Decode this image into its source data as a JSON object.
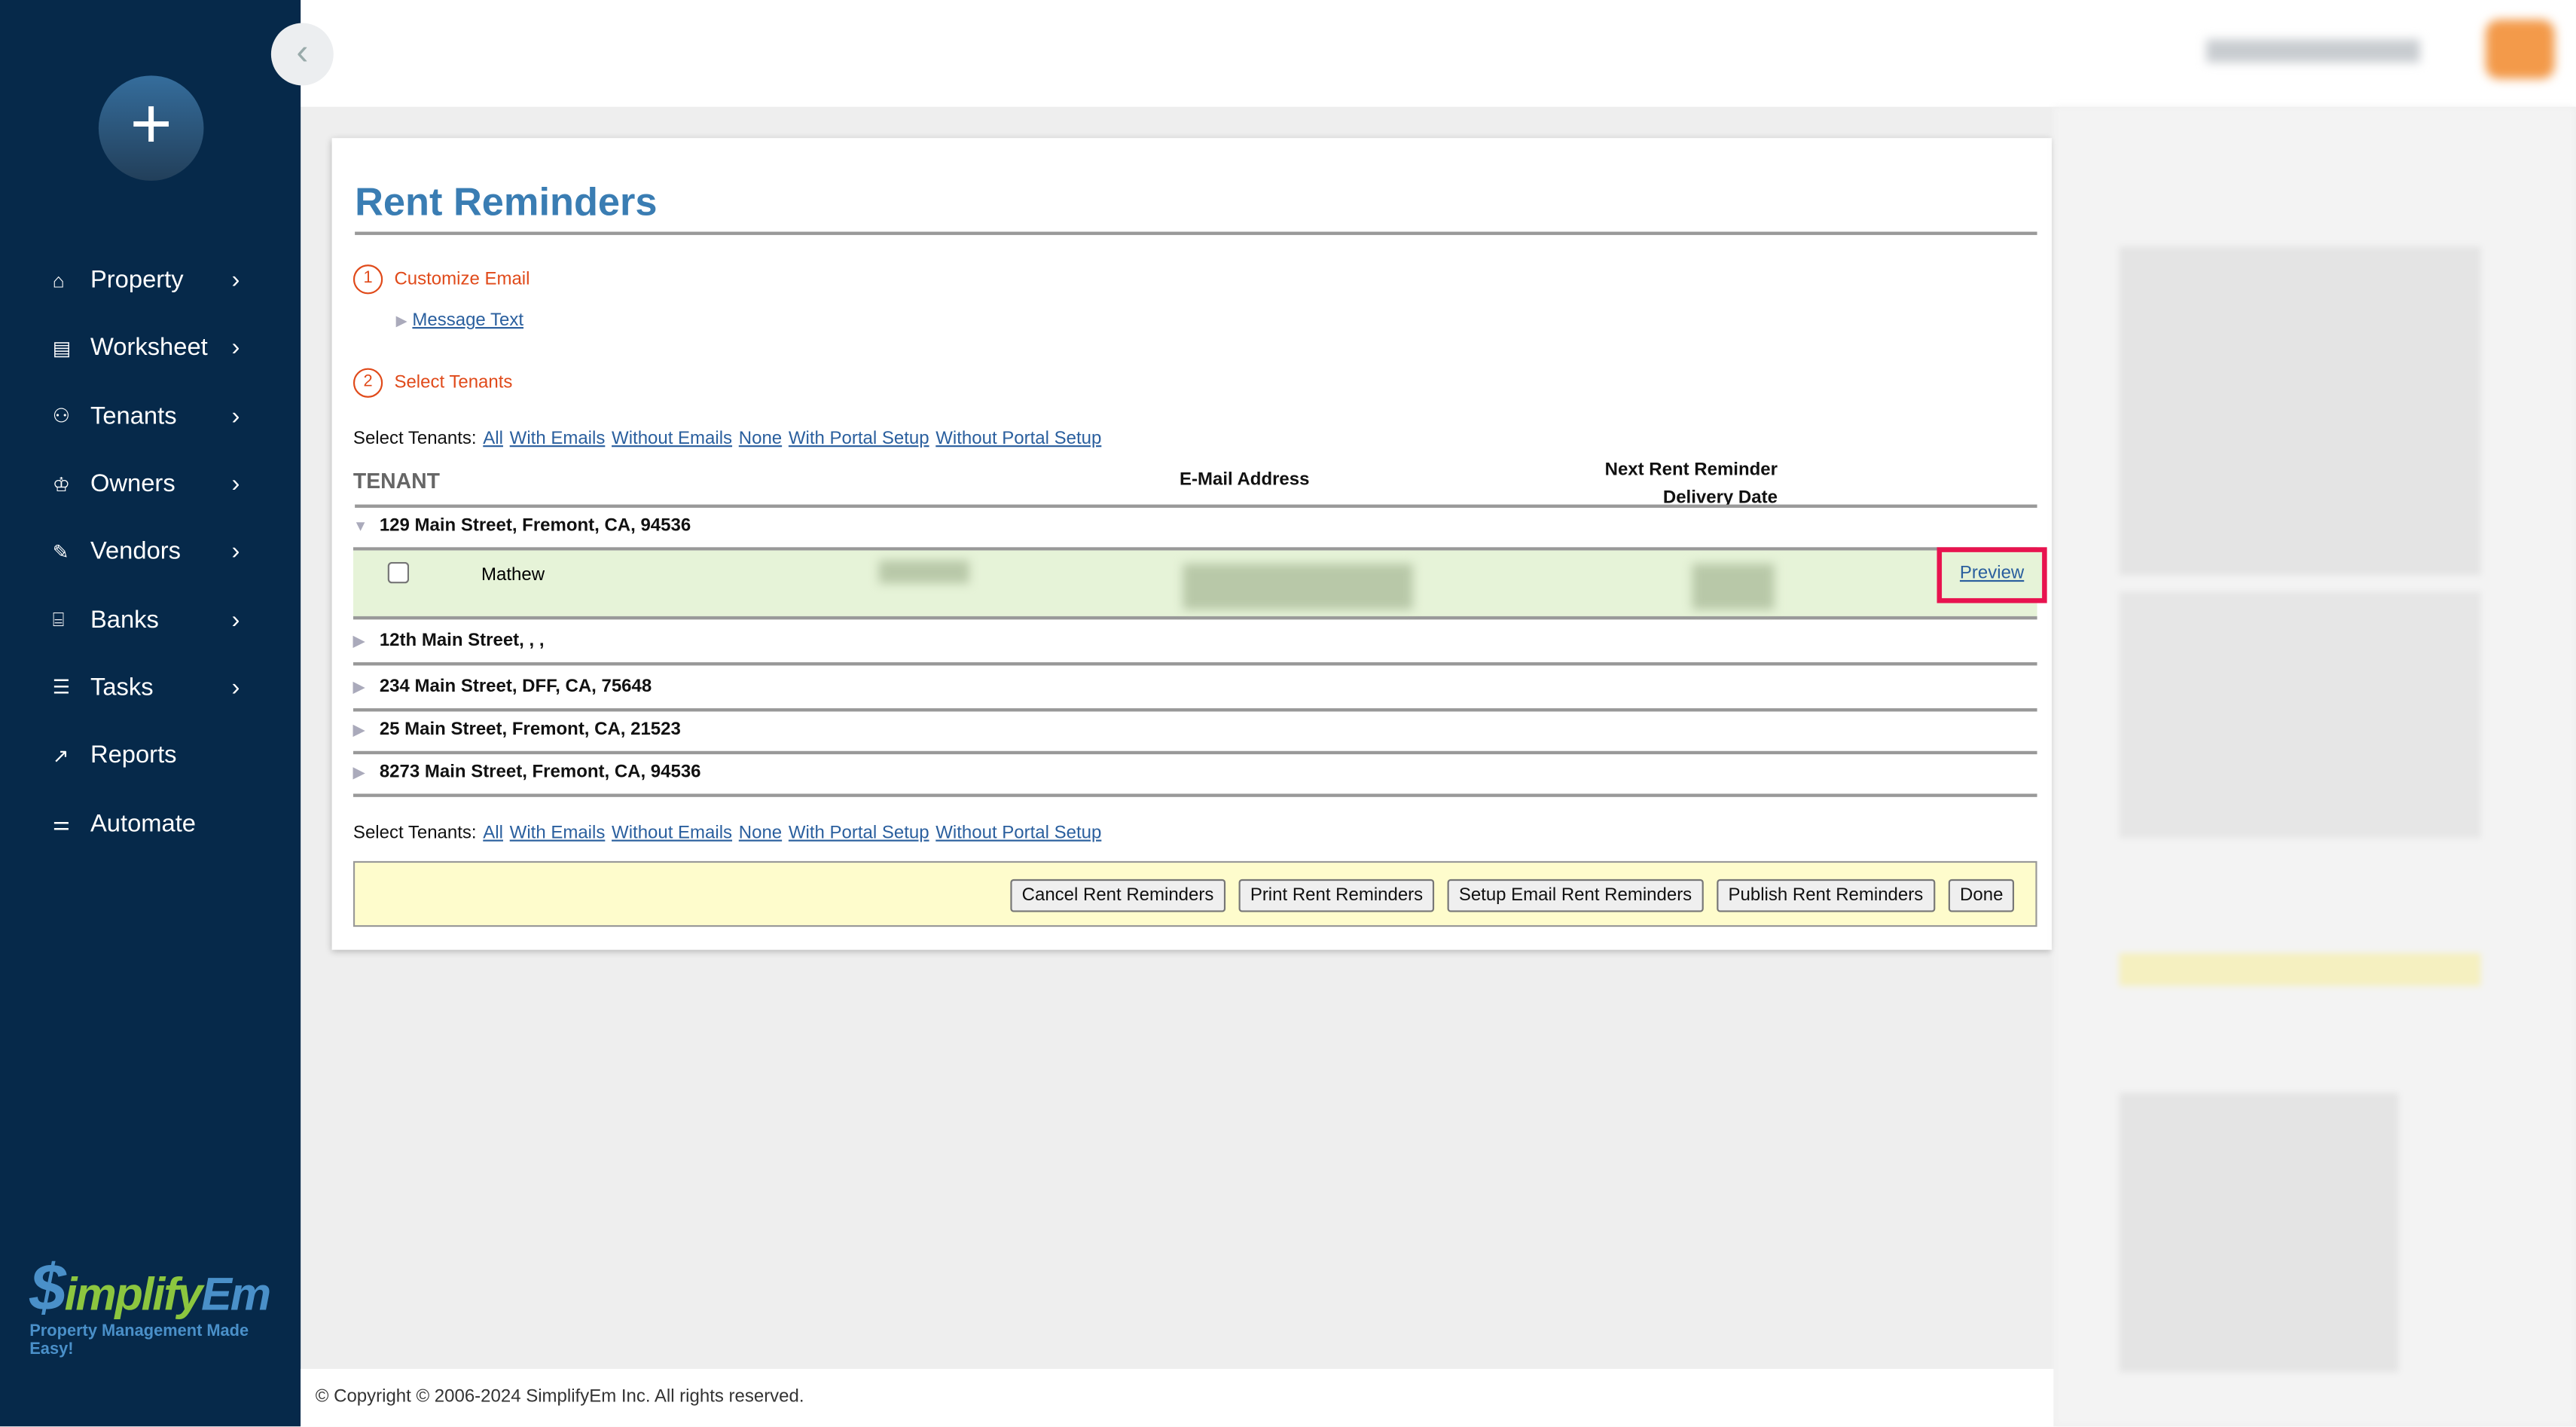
{
  "sidebar": {
    "items": [
      {
        "label": "Property",
        "icon": "home-icon",
        "chev": true
      },
      {
        "label": "Worksheet",
        "icon": "table-icon",
        "chev": true
      },
      {
        "label": "Tenants",
        "icon": "users-icon",
        "chev": true
      },
      {
        "label": "Owners",
        "icon": "crown-icon",
        "chev": true
      },
      {
        "label": "Vendors",
        "icon": "wrench-icon",
        "chev": true
      },
      {
        "label": "Banks",
        "icon": "bank-icon",
        "chev": true
      },
      {
        "label": "Tasks",
        "icon": "tasks-icon",
        "chev": true
      },
      {
        "label": "Reports",
        "icon": "chart-icon",
        "chev": false
      },
      {
        "label": "Automate",
        "icon": "sliders-icon",
        "chev": false
      }
    ],
    "logo": {
      "dollar": "$",
      "g": "implify",
      "b": "Em",
      "tagline": "Property Management Made Easy!"
    }
  },
  "page": {
    "title": "Rent Reminders",
    "step1": {
      "num": "1",
      "label": "Customize Email",
      "link": "Message Text"
    },
    "step2": {
      "num": "2",
      "label": "Select Tenants"
    },
    "select": {
      "label": "Select Tenants:",
      "links": [
        "All",
        "With Emails",
        "Without Emails",
        "None",
        "With Portal Setup",
        "Without Portal Setup"
      ]
    },
    "headers": {
      "tenant": "TENANT",
      "email": "E-Mail Address",
      "next1": "Next Rent Reminder",
      "next2": "Delivery Date"
    },
    "properties": [
      "129 Main Street, Fremont, CA, 94536",
      "12th Main Street, , ,",
      "234 Main Street, DFF, CA, 75648",
      "25 Main Street, Fremont, CA, 21523",
      "8273 Main Street, Fremont, CA, 94536"
    ],
    "tenant": {
      "name": "Mathew",
      "preview": "Preview"
    },
    "buttons": [
      "Cancel Rent Reminders",
      "Print Rent Reminders",
      "Setup Email Rent Reminders",
      "Publish Rent Reminders",
      "Done"
    ]
  },
  "footer": "© Copyright © 2006-2024 SimplifyEm Inc. All rights reserved.",
  "colors": {
    "sidebar": "#06294a",
    "accent": "#3a7db3",
    "step": "#e04a1a",
    "highlight": "#e8134f"
  }
}
